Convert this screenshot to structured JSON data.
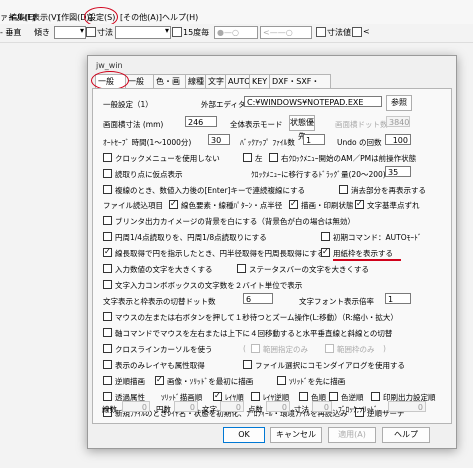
{
  "menu": {
    "items": [
      "ファイル(F)",
      "編集(E)",
      "表示(V)",
      "[作図(D)]",
      "設定(S)",
      "[その他(A)]",
      "ヘルプ(H)"
    ]
  },
  "toolbar": {
    "line_type": "- 垂直",
    "tilt": "傾き",
    "dimension": "寸法",
    "chk15": "15度毎",
    "dim_value": "寸法値",
    "lt": "<"
  },
  "dialog": {
    "title": "jw_win",
    "tabs": [
      "一般(1)",
      "一般(2)",
      "色・画面",
      "線種",
      "文字",
      "AUTO",
      "KEY",
      "DXF・SXF・JWC"
    ],
    "general_header": "一般設定（1）",
    "editor_label": "外部エディタ",
    "editor_value": "C:¥WINDOWS¥NOTEPAD.EXE",
    "browse": "参照",
    "scroll_label": "画面横寸法 (mm)",
    "scroll_value": "246",
    "fullmode_label": "全体表示モード",
    "fullmode_btn": "状態優先",
    "dots_label": "画面横ドット数",
    "dots_value": "3840",
    "autosave_label": "ｵｰﾄｾｰﾌﾞ 時間(1～1000分)",
    "autosave_value": "30",
    "backup_label": "ﾊﾞｯｸｱｯﾌﾟ ﾌｧｲﾙ数",
    "backup_value": "1",
    "undo_label": "Undo の回数",
    "undo_value": "100",
    "rows": [
      {
        "label": "クロックメニューを使用しない",
        "checked": false
      },
      {
        "label": "左",
        "checked": false
      },
      {
        "label": "右ｸﾛｯｸﾒﾆｭｰ開始のAM／PMは前操作状態",
        "checked": false
      },
      {
        "label": "読取り点に仮点表示",
        "checked": false
      },
      {
        "label": "ｸﾛｯｸﾒﾆｭｰに移行するﾄﾞﾗｯｸﾞ量(20～200)",
        "value": "35"
      },
      {
        "label": "複線のとき、数値入力後の[Enter]キーで連続複線にする",
        "checked": false
      },
      {
        "label": "消去部分を再表示する",
        "checked": false
      },
      {
        "label": "ファイル読込項目",
        "checked": null
      },
      {
        "label": "線色要素・線種ﾊﾟﾀｰﾝ・点半径",
        "checked": true
      },
      {
        "label": "描画・印刷状態",
        "checked": true
      },
      {
        "label": "文字基準点ずれ",
        "checked": true
      },
      {
        "label": "ブリンタ出力カイメージの背景を白にする（背景色が白の場合は無効）",
        "checked": false
      },
      {
        "label": "円周1/4点読取りを、円周1/8点読取りにする",
        "checked": false
      },
      {
        "label": "初期コマンド：AUTOﾓｰﾄﾞ",
        "checked": false
      },
      {
        "label": "線長取得で円を指示したとき、円半径取得を円周長取得にする",
        "checked": true
      },
      {
        "label": "用紙枠を表示する",
        "checked": true
      },
      {
        "label": "入力数値の文字を大きくする",
        "checked": false
      },
      {
        "label": "ステータスバーの文字を大きくする",
        "checked": false
      },
      {
        "label": "文字入力コンボボックスの文字数を２バイト単位で表示",
        "checked": false
      },
      {
        "label": "文字表示と枠表示の切替ドット数",
        "value": "6"
      },
      {
        "label": "文字フォント表示倍率",
        "value": "1"
      },
      {
        "label": "マウスの左または右ボタンを押して１秒待つとズーム操作(L:移動）（R:縮小・拡大）",
        "checked": false
      },
      {
        "label": "軸コマンドでマウスを左右または上下に４回移動すると水平垂直線と斜線との切替",
        "checked": false
      },
      {
        "label": "クロスラインカーソルを使う",
        "checked": false
      },
      {
        "label": "範囲指定のみ",
        "checked": false
      },
      {
        "label": "範囲枠のみ",
        "checked": false
      },
      {
        "label": "表示のみレイヤも属性取得",
        "checked": false
      },
      {
        "label": "ファイル選択にコモンダイアログを使用する",
        "checked": false
      },
      {
        "label": "逆順描画",
        "checked": false
      },
      {
        "label": "画像・ｿﾘｯﾄﾞを最初に描画",
        "checked": true
      },
      {
        "label": "ｿﾘｯﾄﾞを先に描画",
        "checked": false
      },
      {
        "label": "透過属性",
        "checked": false
      },
      {
        "label": "ｿﾘｯﾄﾞ描画順",
        "checked": null
      },
      {
        "label": "ﾚｲﾔ順",
        "checked": true
      },
      {
        "label": "ﾚｲﾔ逆順",
        "checked": false
      },
      {
        "label": "色順",
        "checked": false
      },
      {
        "label": "色逆順",
        "checked": false
      },
      {
        "label": "印刷出力設定順",
        "checked": false
      },
      {
        "label": "新規ﾌｧｲﾙのときﾚｲﾔ名・状態を初期化、ﾌﾟﾛﾌｨｰﾙ・環境ﾌｧｲﾙを再読込み",
        "checked": false
      },
      {
        "label": "逆順サーチ",
        "checked": false
      }
    ],
    "counts": {
      "line_label": "線数",
      "line_value": "0",
      "circle_label": "円数",
      "circle_value": "0",
      "text_label": "文字",
      "text_value": "0",
      "point_label": "点数",
      "point_value": "0",
      "dim_label": "寸法",
      "dim_value": "0",
      "block_label": "ﾌﾞﾛｯｸ,ｿﾘｯﾄﾞ",
      "block_value": "0"
    },
    "buttons": {
      "ok": "OK",
      "cancel": "キャンセル",
      "apply": "適用(A)",
      "help": "ヘルプ"
    }
  },
  "colors": {
    "accent_red": "#d0021b",
    "focus_blue": "#0078d4"
  }
}
